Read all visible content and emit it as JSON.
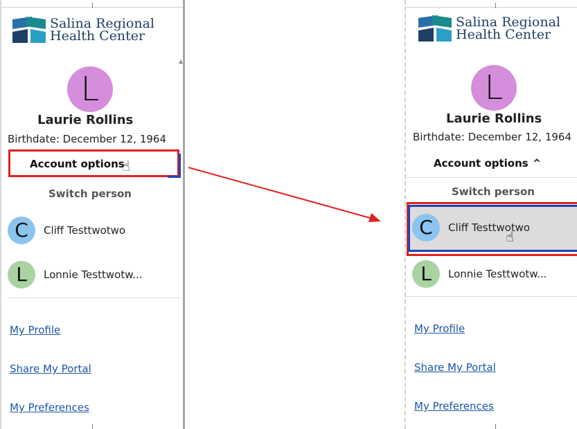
{
  "brand": {
    "line1": "Salina Regional",
    "line2": "Health Center"
  },
  "patient": {
    "initial": "L",
    "name": "Laurie Rollins",
    "birthdate": "Birthdate: December 12, 1964"
  },
  "before": {
    "account_options": "Account options"
  },
  "after": {
    "account_options": "Account options",
    "chevron": "^"
  },
  "switch_person": "Switch person",
  "people": [
    {
      "initial": "C",
      "name": "Cliff Testtwotwo"
    },
    {
      "initial": "L",
      "name": "Lonnie Testtwotw..."
    }
  ],
  "links": [
    "My Profile",
    "Share My Portal",
    "My Preferences"
  ],
  "colors": {
    "avatar_main": "#d58edb",
    "avatar_blue": "#8cc4f0",
    "avatar_green": "#a9d3a0",
    "highlight_red": "#e0201d",
    "highlight_blue": "#1e44b5",
    "arrow": "#e0201d"
  },
  "icons": {
    "cursor": "hand-pointer-icon",
    "logo": "logo-icon",
    "chevron": "chevron-up-icon"
  }
}
